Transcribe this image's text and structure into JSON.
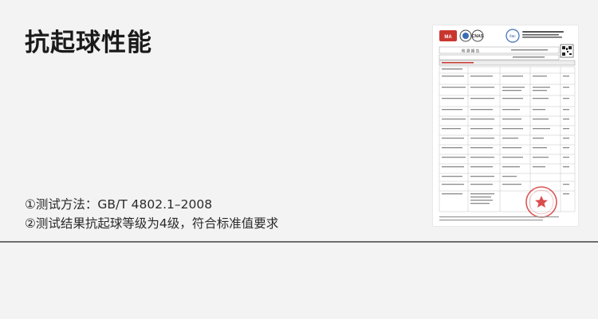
{
  "title": "抗起球性能",
  "lines": {
    "method": "①测试方法：GB/T 4802.1–2008",
    "result": "②测试结果抗起球等级为4级，符合标准值要求"
  },
  "report": {
    "header": "检 测 报 告",
    "logos": [
      "CMA",
      "CNAS",
      "ilac-MRA"
    ],
    "seal_color": "#d63a3a",
    "accent_red": "#c8372f",
    "qr": "qr-code"
  }
}
